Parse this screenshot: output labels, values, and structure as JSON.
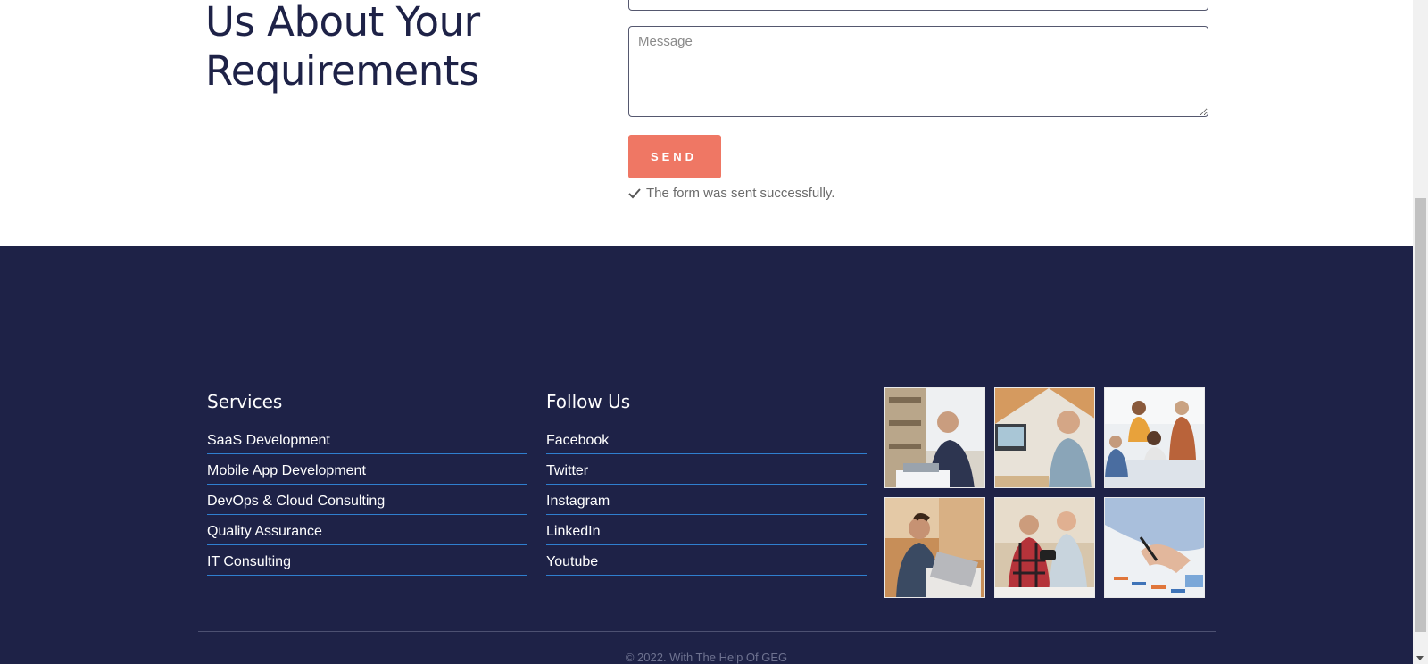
{
  "contact": {
    "heading_lines": [
      "Us About Your",
      "Requirements"
    ],
    "message_placeholder": "Message",
    "send_label": "SEND",
    "success_text": "The form was sent successfully."
  },
  "footer": {
    "services": {
      "title": "Services",
      "links": [
        "SaaS Development",
        "Mobile App Development",
        "DevOps & Cloud Consulting",
        "Quality Assurance",
        "IT Consulting"
      ]
    },
    "follow": {
      "title": "Follow Us",
      "links": [
        "Facebook",
        "Twitter",
        "Instagram",
        "LinkedIn",
        "Youtube"
      ]
    },
    "gallery": [
      {
        "icon": "photo-man-laptop-office"
      },
      {
        "icon": "photo-smiling-man-arms-crossed"
      },
      {
        "icon": "photo-team-meeting"
      },
      {
        "icon": "photo-man-working-laptop"
      },
      {
        "icon": "photo-two-men-vr-headset"
      },
      {
        "icon": "photo-hand-writing-charts"
      }
    ],
    "copyright": "© 2022. With The Help Of GEG"
  },
  "colors": {
    "heading": "#1e2247",
    "footer_bg": "#1e2247",
    "send_button": "#ef7764",
    "link_underline": "#2f7fcf"
  }
}
